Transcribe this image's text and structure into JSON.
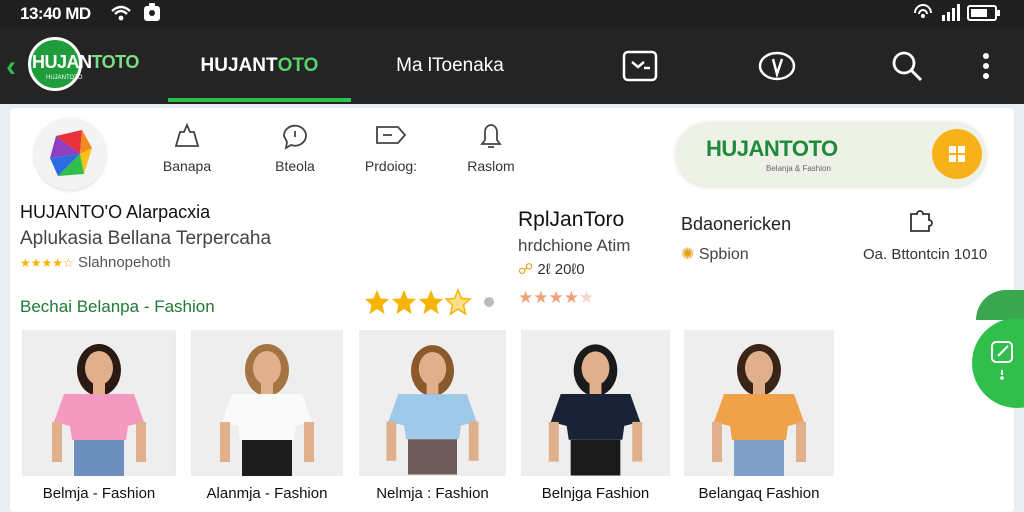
{
  "status": {
    "time": "13:40 MD"
  },
  "appbar": {
    "logo_word_a": "HUJAN",
    "logo_word_b": "TOTO",
    "logo_sub": "HUJANTOTO",
    "tabs": [
      {
        "label_a": "HUJANT",
        "label_b": "OTO"
      },
      {
        "label": "Ma lToenaka"
      }
    ]
  },
  "categories": [
    {
      "label": "Banapa"
    },
    {
      "label": "Bteola"
    },
    {
      "label": "Prdoiog:"
    },
    {
      "label": "Raslom"
    }
  ],
  "banner": {
    "title": "HUJANTOTO",
    "subtitle": "Belanja & Fashion",
    "button_icon": "grid-icon"
  },
  "app": {
    "name": "HUJANTO'O Alarpacxia",
    "tagline": "Aplukasia Bellana Terpercaha",
    "rating_text": "Slahnopehoth",
    "section_title": "Bechai Belanpa - Fashion"
  },
  "meta": {
    "brand": "RplJanToro",
    "brand_sub": "hrdchione Atim",
    "brand_count": "2ℓ 20ℓ0",
    "dev": "Bdaonericken",
    "dev_sub": "Spbion",
    "date": "Oa. Bttontcin 1010"
  },
  "rating": {
    "stars_shown": 3.5,
    "stars_total": 4,
    "secondary_filled": 4,
    "secondary_total": 5
  },
  "colors": {
    "accent": "#2fbf4a",
    "brand_dark": "#1e8a3a",
    "star": "#f5b400",
    "appbar": "#242424"
  },
  "products": [
    {
      "caption": "Belmja - Fashion",
      "shirt": "#f49ac1",
      "hair": "#2a1a12",
      "bottom": "#6c8fbf"
    },
    {
      "caption": "Alanmja - Fashion",
      "shirt": "#fafafa",
      "hair": "#a47442",
      "bottom": "#1c1c1c"
    },
    {
      "caption": "Nelmja : Fashion",
      "shirt": "#9ec9e8",
      "hair": "#8b5a2b",
      "bottom": "#6e5a5a"
    },
    {
      "caption": "Belnjga Fashion",
      "shirt": "#1a2336",
      "hair": "#1a1a1a",
      "bottom": "#1a1a1a"
    },
    {
      "caption": "Belangaɋ Fashion",
      "shirt": "#f0a24a",
      "hair": "#3a2418",
      "bottom": "#7ea0c9"
    }
  ]
}
